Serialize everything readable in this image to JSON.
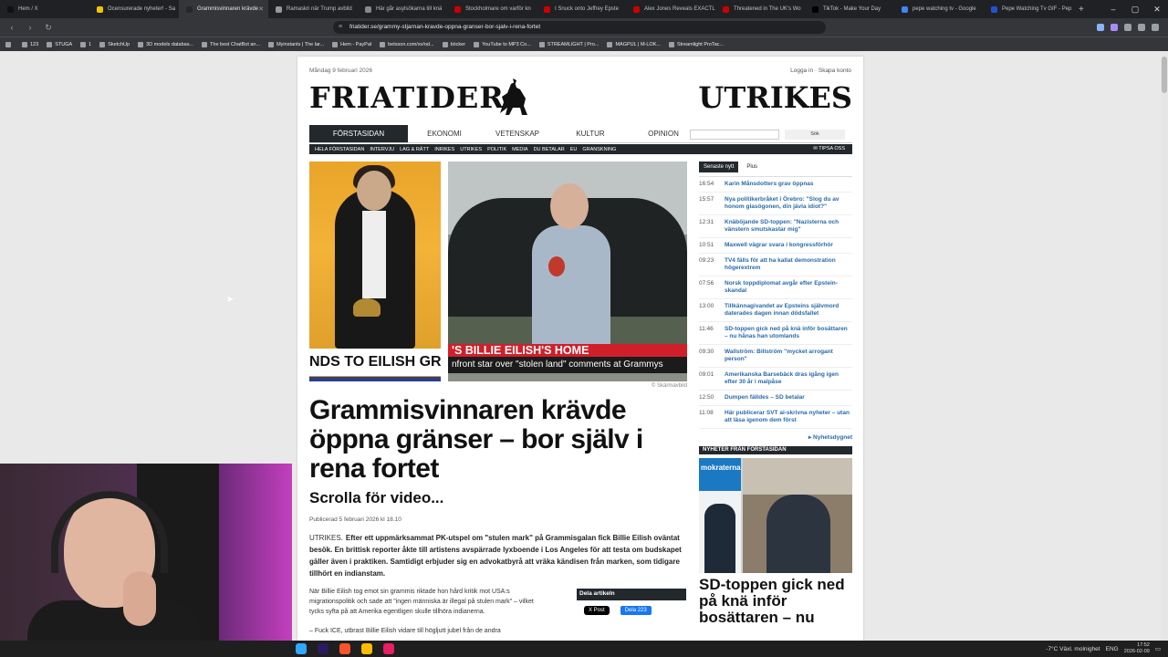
{
  "browser": {
    "tabs": [
      {
        "title": "Hem / X",
        "color": "#111111"
      },
      {
        "title": "Ocensurerade nyheter! - Sa",
        "color": "#f5c400"
      },
      {
        "title": "Grammisvinnaren krävde",
        "color": "#23282d",
        "active": true
      },
      {
        "title": "Ramaskri när Trump avbild",
        "color": "#999999"
      },
      {
        "title": "Här går asylsökarna till knä",
        "color": "#888888"
      },
      {
        "title": "Stockholmare om varför kn",
        "color": "#cc0000"
      },
      {
        "title": "I Snuck onto Jeffrey Epste",
        "color": "#cc0000"
      },
      {
        "title": "Alex Jones Reveals EXACTL",
        "color": "#cc0000"
      },
      {
        "title": "Threatened in The UK's Wo",
        "color": "#cc0000"
      },
      {
        "title": "TikTok - Make Your Day",
        "color": "#000000"
      },
      {
        "title": "pepe watching tv - Google",
        "color": "#4285f4"
      },
      {
        "title": "Pepe Watching Tv GIF - Pep",
        "color": "#2255cc"
      }
    ],
    "url": "friatider.se/grammy-stjarnan-kravde-oppna-granser-bor-sjalv-i-rena-fortet",
    "bookmarks": [
      "123",
      "STUGA",
      "1",
      "SketchUp",
      "3D models databas...",
      "The best ChatBot an...",
      "Myinstants | The lar...",
      "Hem - PayPal",
      "betsson.com/sv/od...",
      "böcker",
      "YouTube to MP3 Co...",
      "STREAMLIGHT | Pro...",
      "MAGPUL | M-LOK...",
      "Streamlight ProTac..."
    ]
  },
  "page": {
    "date": "Måndag 9 februari 2026",
    "login": "Logga in · Skapa konto",
    "logo": "FRIATIDER",
    "section": "UTRIKES",
    "main_nav": [
      "Förstasidan",
      "Ekonomi",
      "Vetenskap",
      "Kultur",
      "Opinion"
    ],
    "search_btn": "Sök",
    "sub_nav": [
      "Hela förstasidan",
      "Intervju",
      "Lag & rätt",
      "Inrikes",
      "Utrikes",
      "Politik",
      "Media",
      "Du betalar",
      "EU",
      "Granskning"
    ],
    "tipsa": "TIPSA OSS",
    "hero_ticker_left": "NDS TO EILISH GRAM",
    "hero_ticker_right": "'S BILLIE EILISH'S HOME",
    "hero_ticker_right_sub": "nfront star over \"stolen land\" comments at Grammys",
    "credit": "© Skärmavbild",
    "headline": "Grammisvinnaren krävde öppna gränser – bor själv i rena fortet",
    "subhead": "Scrolla för video...",
    "published": "Publicerad 5 februari 2026 kl 18.10",
    "kicker": "UTRIKES.",
    "lead": "Efter ett uppmärksammat PK-utspel om \"stulen mark\" på Grammisgalan fick Billie Eilish oväntat besök. En brittisk reporter åkte till artistens avspärrade lyxboende i Los Angeles för att testa om budskapet gäller även i praktiken. Samtidigt erbjuder sig en advokatbyrå att vräka kändisen från marken, som tidigare tillhört en indianstam.",
    "body1": "När Billie Eilish tog emot sin grammis riktade hon hård kritik mot USA:s migrationspolitik och sade att \"ingen människa är illegal på stulen mark\" – vilket tycks syfta på att Amerika egentligen skulle tillhöra indianerna.",
    "body2": "– Fuck ICE, utbrast Billie Eilish vidare till högljutt jubel från de andra",
    "share_title": "Dela artikeln",
    "share_x": "X Post",
    "share_fb": "Dela 223"
  },
  "sidebar": {
    "tabs": [
      "Senaste nytt",
      "Plus"
    ],
    "news": [
      {
        "time": "16:54",
        "title": "Karin Månsdotters grav öppnas"
      },
      {
        "time": "15:57",
        "title": "Nya politikerbråket i Örebro: \"Slog du av honom glasögonen, din jävla idiot?\""
      },
      {
        "time": "12:31",
        "title": "Knäböjande SD-toppen: \"Nazisterna och vänstern smutskastar mig\""
      },
      {
        "time": "10:51",
        "title": "Maxwell vägrar svara i kongressförhör"
      },
      {
        "time": "09:23",
        "title": "TV4 fälls för att ha kallat demonstration högerextrem"
      },
      {
        "time": "07:56",
        "title": "Norsk toppdiplomat avgår efter Epstein-skandal"
      },
      {
        "time": "13:00",
        "title": "Tillkännagivandet av Epsteins självmord daterades dagen innan dödsfallet"
      },
      {
        "time": "11:46",
        "title": "SD-toppen gick ned på knä inför bosättaren – nu hånas han utomlands"
      },
      {
        "time": "09:30",
        "title": "Wallström: Billström \"mycket arrogant person\""
      },
      {
        "time": "09:01",
        "title": "Amerikanska Barsebäck dras igång igen efter 30 år i malpåse"
      },
      {
        "time": "12:50",
        "title": "Dumpen fälldes – SD betalar"
      },
      {
        "time": "11:08",
        "title": "Här publicerar SVT ai-skrivna nyheter – utan att läsa igenom dem först"
      }
    ],
    "more": "▸ Nyhetsdygnet",
    "from_front": "NYHETER FRÅN FÖRSTASIDAN",
    "image_text": "mokraterna",
    "front_headline": "SD-toppen gick ned på knä inför bosättaren – nu"
  },
  "taskbar": {
    "weather": "-7°C  Växl. molnighet",
    "lang": "ENG",
    "time": "17:52",
    "date": "2026-02-09"
  }
}
